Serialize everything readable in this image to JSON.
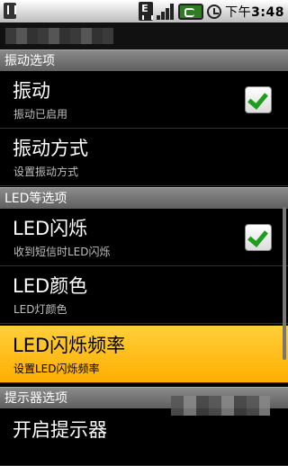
{
  "status_bar": {
    "icons": [
      "usb-icon",
      "data-e-icon",
      "signal-icon",
      "battery-icon",
      "alarm-icon"
    ],
    "data_letter": "E",
    "time_ampm": "下午",
    "time": "3:48"
  },
  "sections": [
    {
      "header": "振动选项"
    },
    {
      "header": "LED等选项"
    },
    {
      "header": "提示器选项"
    }
  ],
  "items": [
    {
      "title": "振动",
      "subtitle": "振动已启用",
      "checked": true
    },
    {
      "title": "振动方式",
      "subtitle": "设置振动方式"
    },
    {
      "title": "LED闪烁",
      "subtitle": "收到短信时LED闪烁",
      "checked": true
    },
    {
      "title": "LED颜色",
      "subtitle": "LED灯颜色"
    },
    {
      "title": "LED闪烁频率",
      "subtitle": "设置LED闪烁频率",
      "selected": true
    },
    {
      "title": "开启提示器"
    }
  ],
  "colors": {
    "selected_bg": "#ffb800",
    "check_green": "#1d9e1d",
    "section_bg": "#6e6e6e"
  }
}
